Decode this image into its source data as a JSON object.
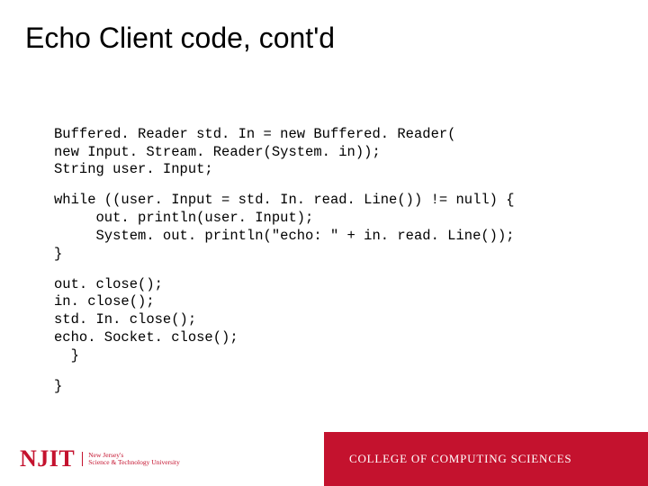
{
  "title": "Echo Client code, cont'd",
  "code": {
    "g1l1": "Buffered. Reader std. In = new Buffered. Reader(",
    "g1l2": "new Input. Stream. Reader(System. in));",
    "g1l3": "String user. Input;",
    "g2l1": "while ((user. Input = std. In. read. Line()) != null) {",
    "g2l2": "     out. println(user. Input);",
    "g2l3": "     System. out. println(\"echo: \" + in. read. Line());",
    "g2l4": "}",
    "g3l1": "out. close();",
    "g3l2": "in. close();",
    "g3l3": "std. In. close();",
    "g3l4": "echo. Socket. close();",
    "g3l5": "  }",
    "g4l1": "}"
  },
  "footer": {
    "njit": "NJIT",
    "njit_sub1": "New Jersey's",
    "njit_sub2": "Science & Technology University",
    "college": "COLLEGE OF COMPUTING SCIENCES"
  }
}
